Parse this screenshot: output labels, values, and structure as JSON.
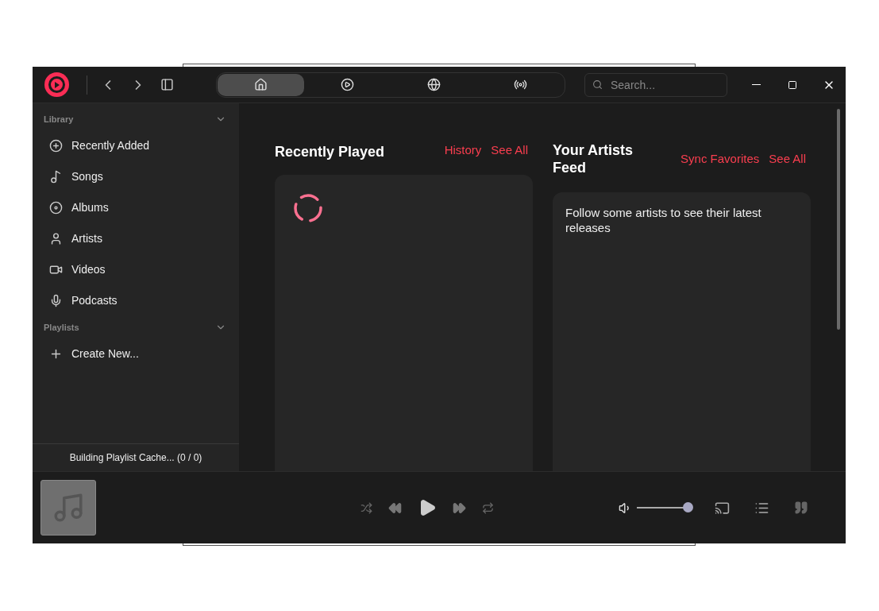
{
  "nav_tabs": [
    {
      "kind": "home",
      "selected": true
    },
    {
      "kind": "play",
      "selected": false
    },
    {
      "kind": "globe",
      "selected": false
    },
    {
      "kind": "radio",
      "selected": false
    }
  ],
  "search": {
    "placeholder": "Search..."
  },
  "sidebar": {
    "sections": [
      {
        "title": "Library",
        "expanded": true,
        "items": [
          {
            "kind": "recent",
            "label": "Recently Added"
          },
          {
            "kind": "songs",
            "label": "Songs"
          },
          {
            "kind": "albums",
            "label": "Albums"
          },
          {
            "kind": "artists",
            "label": "Artists"
          },
          {
            "kind": "videos",
            "label": "Videos"
          },
          {
            "kind": "podcasts",
            "label": "Podcasts"
          }
        ]
      },
      {
        "title": "Playlists",
        "expanded": true,
        "items": [
          {
            "kind": "create",
            "label": "Create New..."
          }
        ]
      }
    ],
    "status": "Building Playlist Cache... (0 / 0)"
  },
  "recently_played": {
    "title": "Recently Played",
    "links": [
      "History",
      "See All"
    ],
    "loading": true
  },
  "artists_feed": {
    "title": "Your Artists Feed",
    "links": [
      "Sync Favorites",
      "See All"
    ],
    "message": "Follow some artists to see their latest releases"
  },
  "player": {
    "volume": {
      "level": 1
    }
  }
}
